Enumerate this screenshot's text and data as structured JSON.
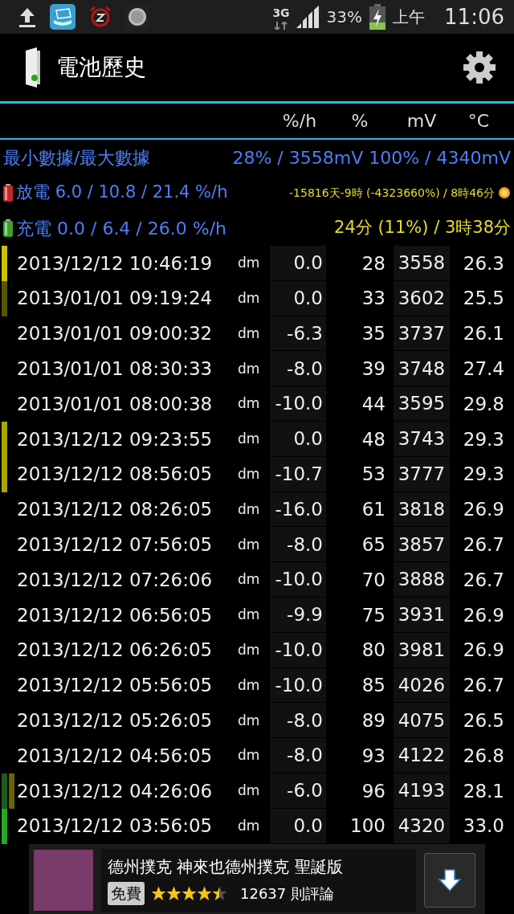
{
  "status_bar": {
    "network": "3G",
    "battery": "33%",
    "period": "上午",
    "time": "11:06"
  },
  "action_bar": {
    "title": "電池歷史"
  },
  "columns": [
    "%/h",
    "%",
    "mV",
    "°C"
  ],
  "summary": {
    "label": "最小數據/最大數據",
    "value": "28% / 3558mV 100% / 4340mV"
  },
  "rates": [
    {
      "kind": "discharge",
      "label": "放電 6.0 / 10.8 / 21.4 %/h",
      "estimate": "-15816天-9時 (-4323660%) / 8時46分"
    },
    {
      "kind": "charge",
      "label": "充電 0.0 / 6.4 / 26.0 %/h",
      "estimate": "24分 (11%) / 3時38分"
    }
  ],
  "rows": [
    {
      "time": "2013/12/12 10:46:19",
      "unit": "dm",
      "rate": "0.0",
      "percent": "28",
      "mv": "3558",
      "temp": "26.3",
      "markers": [
        {
          "color": "#c8c000"
        }
      ]
    },
    {
      "time": "2013/01/01 09:19:24",
      "unit": "dm",
      "rate": "0.0",
      "percent": "33",
      "mv": "3602",
      "temp": "25.5",
      "markers": [
        {
          "color": "#5a5600"
        }
      ]
    },
    {
      "time": "2013/01/01 09:00:32",
      "unit": "dm",
      "rate": "-6.3",
      "percent": "35",
      "mv": "3737",
      "temp": "26.1",
      "markers": []
    },
    {
      "time": "2013/01/01 08:30:33",
      "unit": "dm",
      "rate": "-8.0",
      "percent": "39",
      "mv": "3748",
      "temp": "27.4",
      "markers": []
    },
    {
      "time": "2013/01/01 08:00:38",
      "unit": "dm",
      "rate": "-10.0",
      "percent": "44",
      "mv": "3595",
      "temp": "29.8",
      "markers": []
    },
    {
      "time": "2013/12/12 09:23:55",
      "unit": "dm",
      "rate": "0.0",
      "percent": "48",
      "mv": "3743",
      "temp": "29.3",
      "markers": [
        {
          "color": "#a8a400"
        }
      ]
    },
    {
      "time": "2013/12/12 08:56:05",
      "unit": "dm",
      "rate": "-10.7",
      "percent": "53",
      "mv": "3777",
      "temp": "29.3",
      "markers": [
        {
          "color": "#a8a400"
        }
      ]
    },
    {
      "time": "2013/12/12 08:26:05",
      "unit": "dm",
      "rate": "-16.0",
      "percent": "61",
      "mv": "3818",
      "temp": "26.9",
      "markers": []
    },
    {
      "time": "2013/12/12 07:56:05",
      "unit": "dm",
      "rate": "-8.0",
      "percent": "65",
      "mv": "3857",
      "temp": "26.7",
      "markers": []
    },
    {
      "time": "2013/12/12 07:26:06",
      "unit": "dm",
      "rate": "-10.0",
      "percent": "70",
      "mv": "3888",
      "temp": "26.7",
      "markers": []
    },
    {
      "time": "2013/12/12 06:56:05",
      "unit": "dm",
      "rate": "-9.9",
      "percent": "75",
      "mv": "3931",
      "temp": "26.9",
      "markers": []
    },
    {
      "time": "2013/12/12 06:26:05",
      "unit": "dm",
      "rate": "-10.0",
      "percent": "80",
      "mv": "3981",
      "temp": "26.9",
      "markers": []
    },
    {
      "time": "2013/12/12 05:56:05",
      "unit": "dm",
      "rate": "-10.0",
      "percent": "85",
      "mv": "4026",
      "temp": "26.7",
      "markers": []
    },
    {
      "time": "2013/12/12 05:26:05",
      "unit": "dm",
      "rate": "-8.0",
      "percent": "89",
      "mv": "4075",
      "temp": "26.5",
      "markers": []
    },
    {
      "time": "2013/12/12 04:56:05",
      "unit": "dm",
      "rate": "-8.0",
      "percent": "93",
      "mv": "4122",
      "temp": "26.8",
      "markers": []
    },
    {
      "time": "2013/12/12 04:26:06",
      "unit": "dm",
      "rate": "-6.0",
      "percent": "96",
      "mv": "4193",
      "temp": "28.1",
      "markers": [
        {
          "color": "#1f5a1f"
        },
        {
          "color": "#6b6400"
        }
      ]
    },
    {
      "time": "2013/12/12 03:56:05",
      "unit": "dm",
      "rate": "0.0",
      "percent": "100",
      "mv": "4320",
      "temp": "33.0",
      "markers": [
        {
          "color": "#22aa22"
        }
      ]
    }
  ],
  "ad": {
    "title": "德州撲克 神來也德州撲克 聖誕版",
    "price": "免費",
    "stars": 4.5,
    "reviews": "12637 則評論"
  }
}
